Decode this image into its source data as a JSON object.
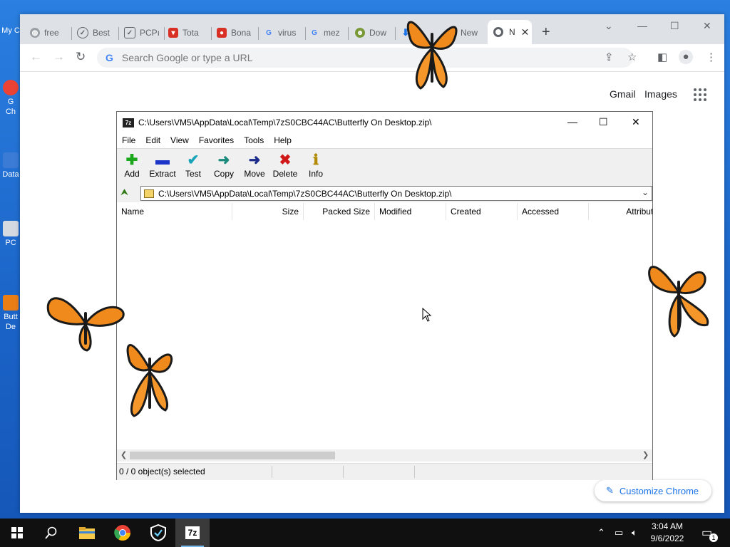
{
  "chrome": {
    "tabs": [
      {
        "label": "free",
        "icon": "globe-icon",
        "color": "#5f6368"
      },
      {
        "label": "Best",
        "icon": "shield-check-icon",
        "color": "#5f6368"
      },
      {
        "label": "PCPı",
        "icon": "shield-check-icon",
        "color": "#5f6368"
      },
      {
        "label": "Tota",
        "icon": "red-shield-icon",
        "color": "#d93025"
      },
      {
        "label": "Bona",
        "icon": "red-badge-icon",
        "color": "#d93025"
      },
      {
        "label": "virus",
        "icon": "google-icon",
        "color": "#4285f4"
      },
      {
        "label": "mez",
        "icon": "google-icon",
        "color": "#4285f4"
      },
      {
        "label": "Dow",
        "icon": "mascot-icon",
        "color": "#7a9a3a"
      },
      {
        "label": "",
        "icon": "download-icon",
        "color": "#1a73e8"
      },
      {
        "label": "New",
        "icon": "chrome-icon",
        "color": "#5f6368"
      }
    ],
    "active_tab_label": "N",
    "omnibox_placeholder": "Search Google or type a URL",
    "ntp_links": {
      "gmail": "Gmail",
      "images": "Images"
    },
    "customize_label": "Customize Chrome"
  },
  "zip": {
    "title": "C:\\Users\\VM5\\AppData\\Local\\Temp\\7zS0CBC44AC\\Butterfly On Desktop.zip\\",
    "logo": "7z",
    "menu": [
      "File",
      "Edit",
      "View",
      "Favorites",
      "Tools",
      "Help"
    ],
    "toolbar": [
      {
        "label": "Add",
        "glyph": "✚",
        "color": "#1aa81a"
      },
      {
        "label": "Extract",
        "glyph": "▬",
        "color": "#1a35c8"
      },
      {
        "label": "Test",
        "glyph": "✔",
        "color": "#17a3b8"
      },
      {
        "label": "Copy",
        "glyph": "➜",
        "color": "#1a8a7a"
      },
      {
        "label": "Move",
        "glyph": "➜",
        "color": "#1a2a8a"
      },
      {
        "label": "Delete",
        "glyph": "✖",
        "color": "#d01818"
      },
      {
        "label": "Info",
        "glyph": "ℹ",
        "color": "#b08a00"
      }
    ],
    "address": "C:\\Users\\VM5\\AppData\\Local\\Temp\\7zS0CBC44AC\\Butterfly On Desktop.zip\\",
    "columns": [
      "Name",
      "Size",
      "Packed Size",
      "Modified",
      "Created",
      "Accessed",
      "Attributes"
    ],
    "status": "0 / 0 object(s) selected"
  },
  "desktop": {
    "icons": [
      {
        "label": "My C",
        "color": "#7fb2ee"
      },
      {
        "label": "G\nCh",
        "color": "#ea4335"
      },
      {
        "label": "Data",
        "color": "#3b7bd6"
      },
      {
        "label": "PC",
        "color": "#d5d9e0"
      },
      {
        "label": "Butt\nDe",
        "color": "#e97d16"
      }
    ]
  },
  "taskbar": {
    "time": "3:04 AM",
    "date": "9/6/2022",
    "notification_count": "1",
    "apps": [
      "start-icon",
      "search-icon",
      "file-explorer-icon",
      "chrome-icon",
      "security-shield-icon",
      "7zip-icon"
    ],
    "active_app_label": "7z"
  }
}
